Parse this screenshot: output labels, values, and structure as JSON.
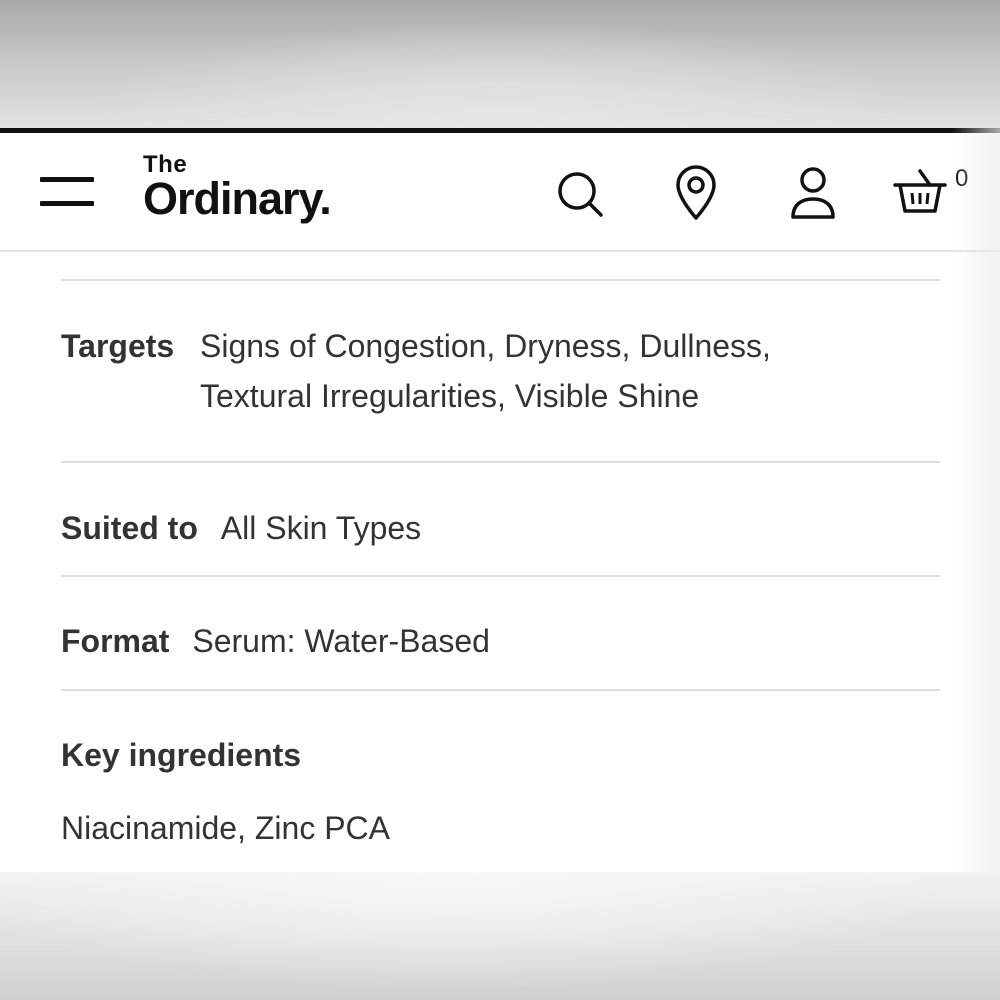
{
  "header": {
    "logo_small": "The",
    "logo_large": "Ordinary.",
    "cart_count": "0"
  },
  "icons": {
    "menu": "menu-icon",
    "search": "search-icon",
    "location": "location-pin-icon",
    "account": "user-icon",
    "cart": "basket-icon",
    "expand": "plus-icon"
  },
  "details": {
    "targets": {
      "label": "Targets",
      "value_line1": "Signs of Congestion, Dryness, Dullness,",
      "value_line2": "Textural Irregularities, Visible Shine"
    },
    "suited_to": {
      "label": "Suited to",
      "value": "All Skin Types"
    },
    "format": {
      "label": "Format",
      "value": "Serum: Water-Based"
    },
    "key_ingredients": {
      "label": "Key ingredients",
      "value": "Niacinamide, Zinc PCA"
    }
  },
  "colors": {
    "text": "#333333",
    "brand": "#111111",
    "divider": "#dcdcdc",
    "button": "#2b2b2b"
  }
}
